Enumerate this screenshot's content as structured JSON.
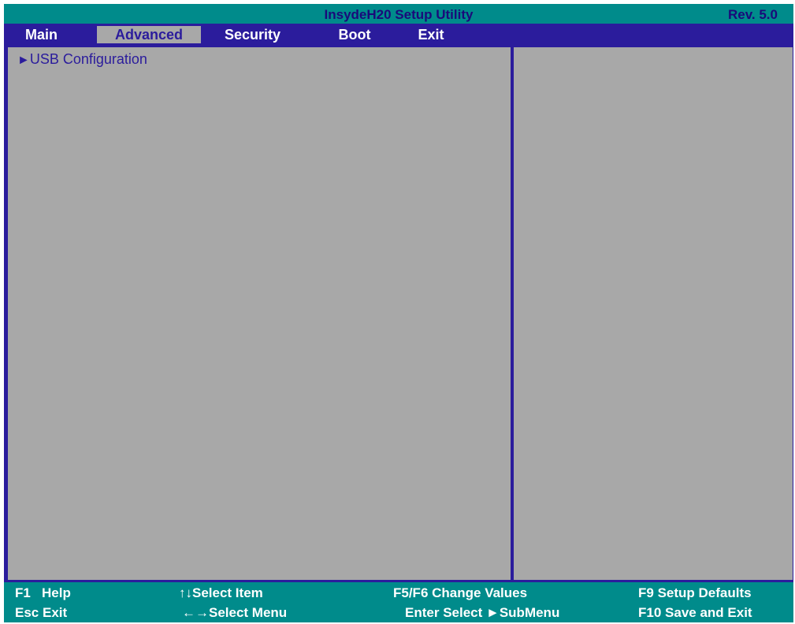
{
  "header": {
    "title": "InsydeH20 Setup Utility",
    "revision": "Rev. 5.0"
  },
  "menu": {
    "tabs": [
      {
        "label": "Main",
        "active": false
      },
      {
        "label": "Advanced",
        "active": true
      },
      {
        "label": "Security",
        "active": false
      },
      {
        "label": "Boot",
        "active": false
      },
      {
        "label": "Exit",
        "active": false
      }
    ]
  },
  "main": {
    "items": [
      {
        "arrow": "►",
        "label": "USB Configuration"
      }
    ]
  },
  "footer": {
    "help": {
      "key": "F1",
      "desc": "Help"
    },
    "select_item": {
      "key": "↑↓",
      "desc": "Select Item"
    },
    "change_values": {
      "key": "F5/F6",
      "desc": "Change Values"
    },
    "setup_defaults": {
      "key": "F9",
      "desc": "Setup Defaults"
    },
    "exit": {
      "key": "Esc",
      "desc": "Exit"
    },
    "select_menu": {
      "key": "←→",
      "desc": "Select Menu"
    },
    "submenu": {
      "key": "Enter",
      "desc": "Select ►SubMenu"
    },
    "save_exit": {
      "key": "F10",
      "desc": "Save and Exit"
    }
  },
  "colors": {
    "frame": "#2B1C9C",
    "title_bar": "#008B8B",
    "panel": "#A8A8A8",
    "active_tab_text": "#2B1C9C"
  }
}
